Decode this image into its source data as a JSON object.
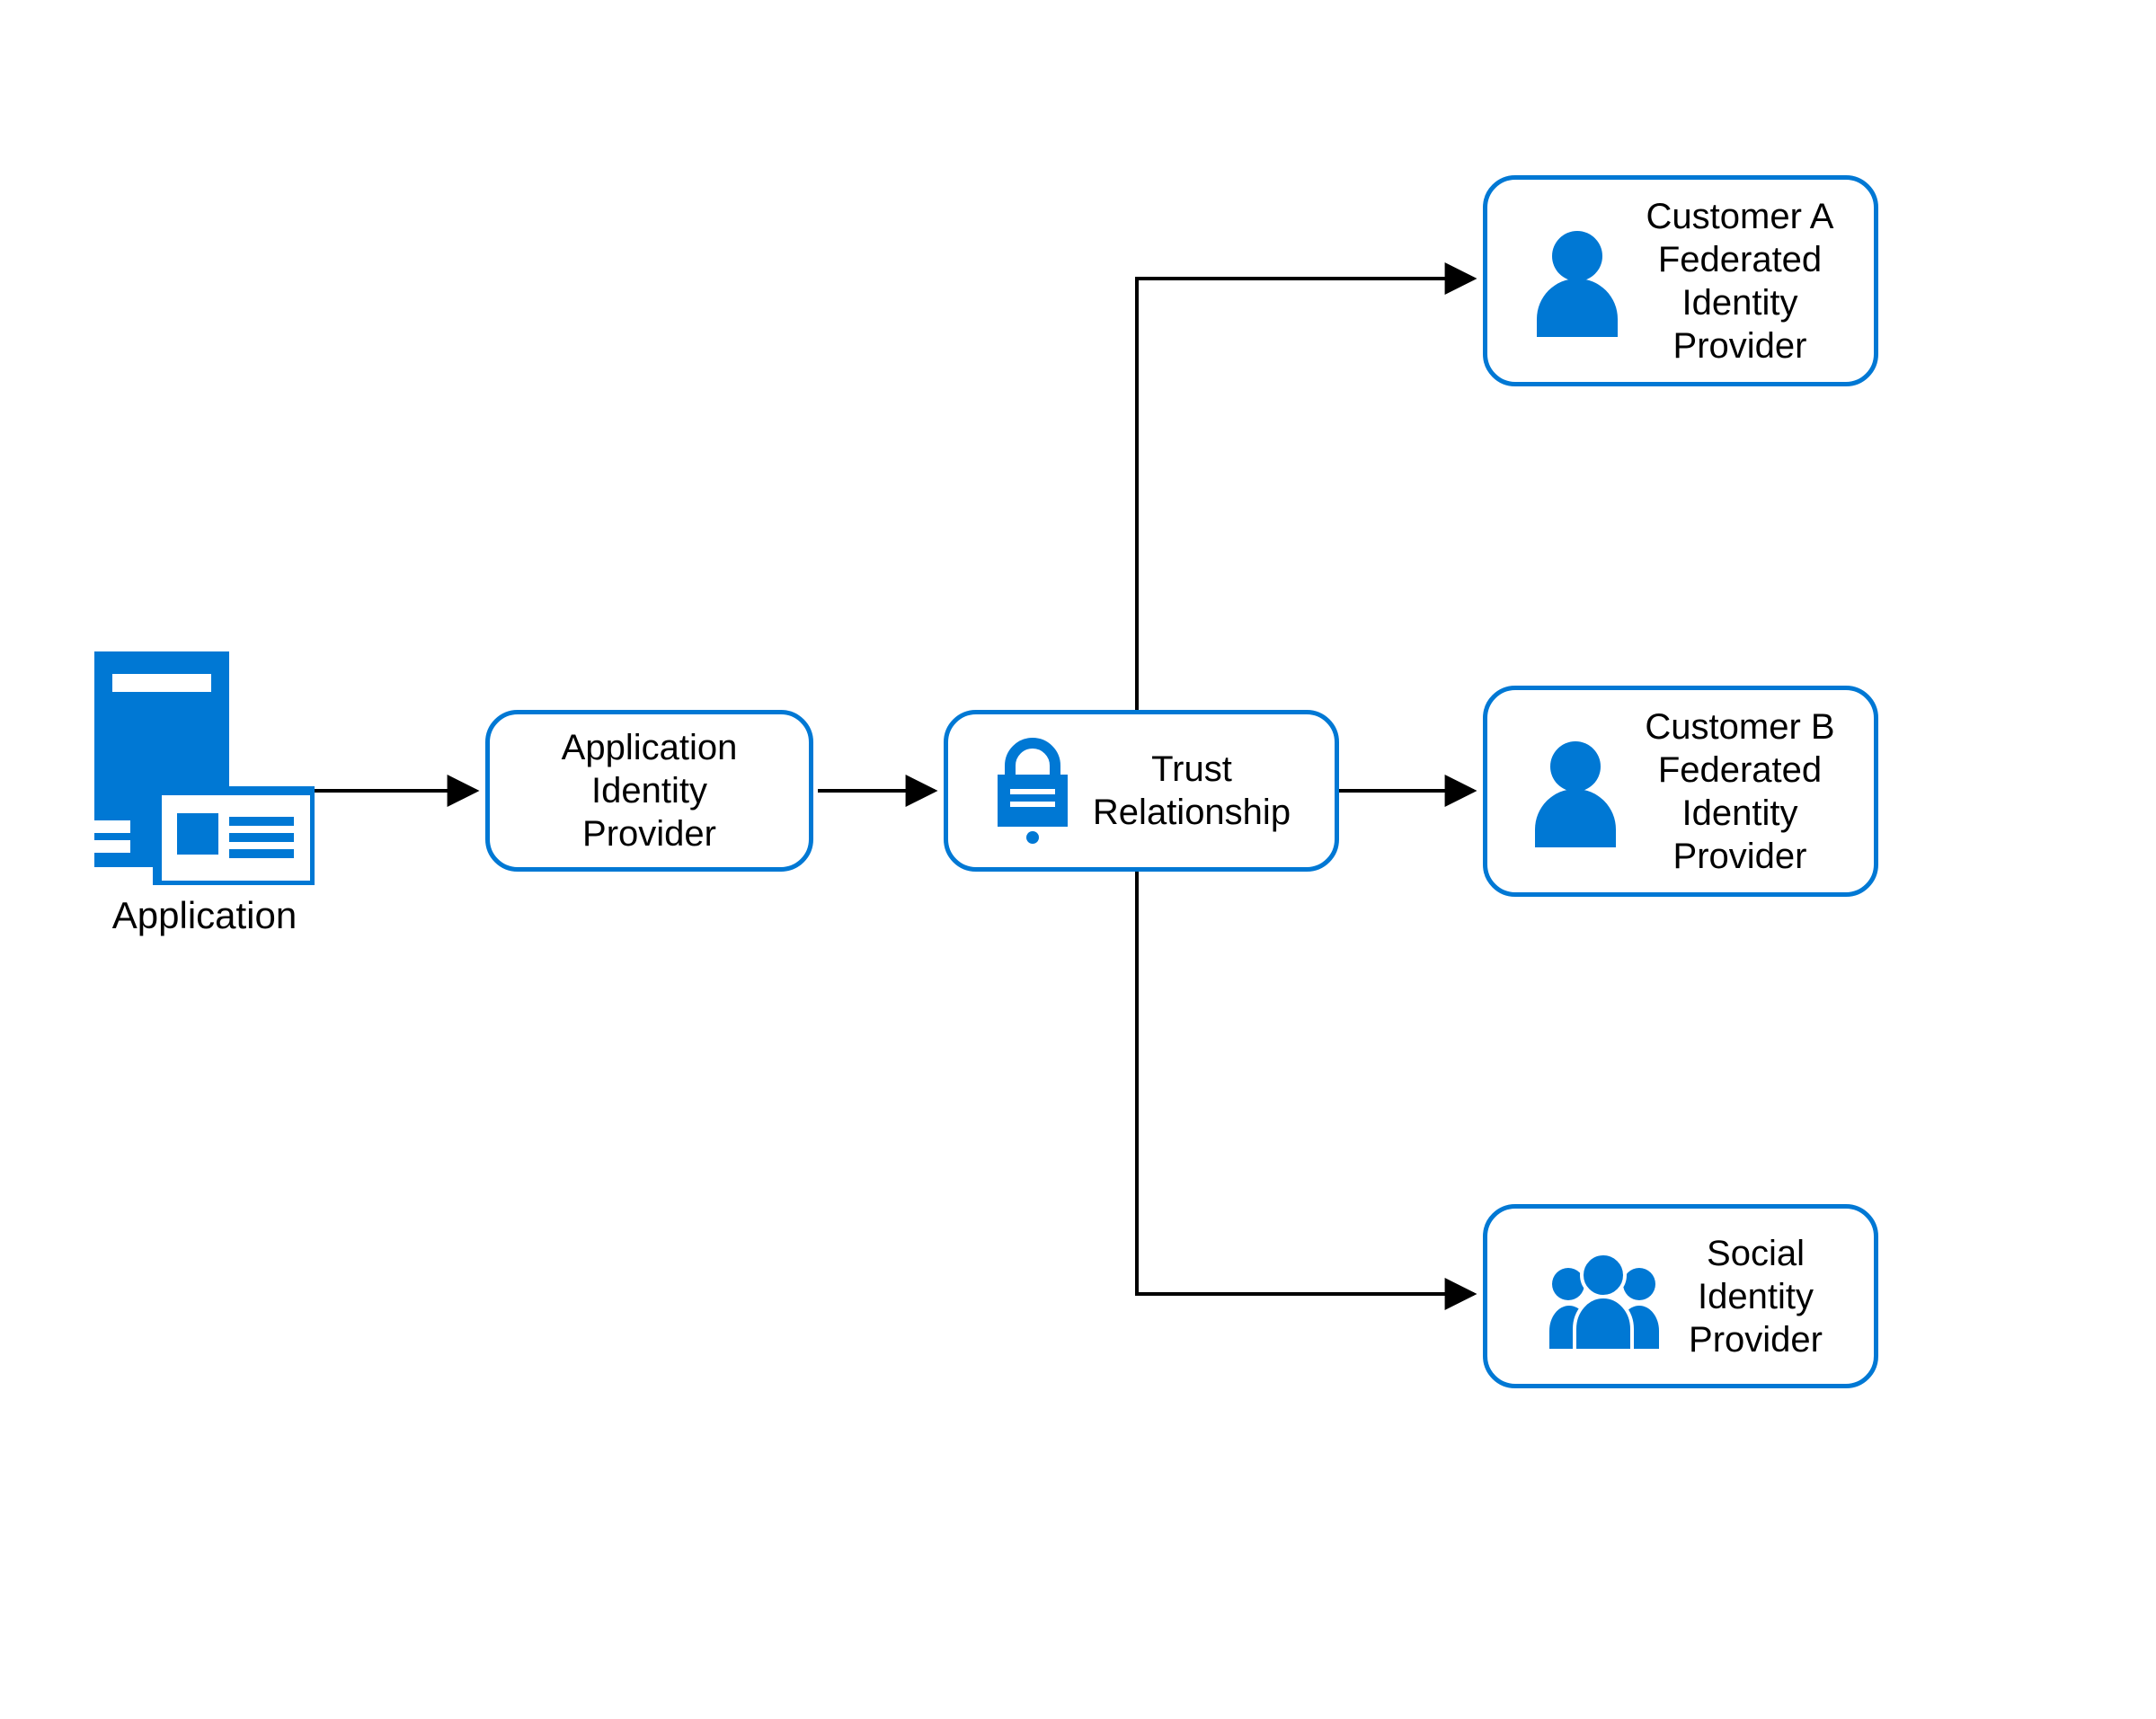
{
  "colors": {
    "accent": "#0078d4",
    "line": "#000000"
  },
  "nodes": {
    "application": {
      "label": "Application"
    },
    "app_idp": {
      "label": "Application\nIdentity\nProvider"
    },
    "trust": {
      "label": "Trust\nRelationship"
    },
    "cust_a": {
      "label": "Customer A\nFederated\nIdentity\nProvider"
    },
    "cust_b": {
      "label": "Customer B\nFederated\nIdentity\nProvider"
    },
    "social": {
      "label": "Social\nIdentity\nProvider"
    }
  },
  "icons": {
    "application": "server-with-monitor-icon",
    "trust": "lock-icon",
    "cust_a": "person-icon",
    "cust_b": "person-icon",
    "social": "people-group-icon"
  }
}
